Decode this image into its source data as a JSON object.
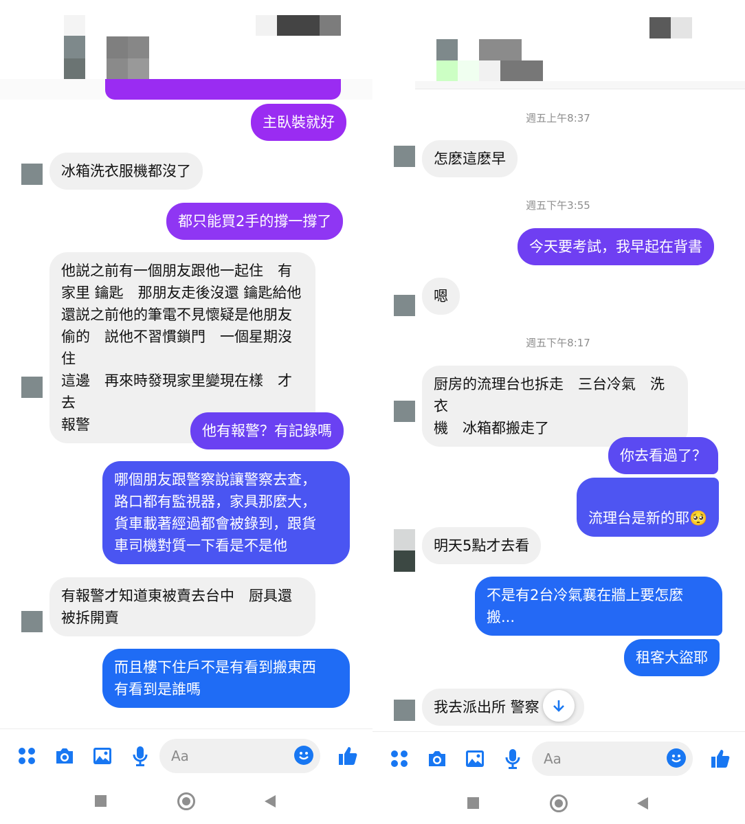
{
  "colors": {
    "purple": "#9a2cf2",
    "violet": "#6a41f2",
    "blue": "#1f6cf5",
    "incoming": "#f0f0f0"
  },
  "left_panel": {
    "messages": [
      {
        "side": "out",
        "text": "主臥裝就好",
        "color": "purple"
      },
      {
        "side": "in",
        "text": "冰箱洗衣服機都沒了"
      },
      {
        "side": "out",
        "text": "都只能買2手的撐一撐了",
        "color": "purple"
      },
      {
        "side": "in",
        "text": "他説之前有一個朋友跟他一起住　有\n家里 鑰匙　那朋友走後沒還 鑰匙給他\n還説之前他的筆電不見懷疑是他朋友\n偷的　説他不習慣鎖門　一個星期沒住\n這邊　再來時發現家里變現在樣　才去\n報警"
      },
      {
        "side": "out",
        "text": "他有報警？有記錄嗎",
        "color": "violet"
      },
      {
        "side": "out",
        "text": "哪個朋友跟警察說讓警察去查，\n路口都有監視器，家具那麼大，\n貨車載著經過都會被錄到，跟貨\n車司機對質一下看是不是他",
        "color": "violet"
      },
      {
        "side": "in",
        "text": "有報警才知道東被賣去台中　厨具還\n被拆開賣"
      },
      {
        "side": "out",
        "text": "而且樓下住戶不是有看到搬東西\n有看到是誰嗎",
        "color": "blue"
      }
    ],
    "composer": {
      "placeholder": "Aa"
    }
  },
  "right_panel": {
    "timestamps": [
      "週五上午8:37",
      "週五下午3:55",
      "週五下午8:17"
    ],
    "messages": [
      {
        "side": "in",
        "text": "怎麽這麽早"
      },
      {
        "side": "out",
        "text": "今天要考試，我早起在背書",
        "color": "violet"
      },
      {
        "side": "in",
        "text": "嗯"
      },
      {
        "side": "in",
        "text": "厨房的流理台也拆走　三台冷氣　洗衣\n機　冰箱都搬走了"
      },
      {
        "side": "out",
        "text": "你去看過了？",
        "color": "violet"
      },
      {
        "side": "out",
        "text": "流理台是新的耶",
        "color": "violet",
        "emoji": "🥺"
      },
      {
        "side": "in",
        "text": "明天5點才去看"
      },
      {
        "side": "out",
        "text": "不是有2台冷氣襄在牆上要怎麼\n搬...",
        "color": "blue"
      },
      {
        "side": "out",
        "text": "租客大盜耶",
        "color": "blue"
      },
      {
        "side": "in",
        "text": "我去派出所 警察"
      }
    ],
    "composer": {
      "placeholder": "Aa"
    }
  }
}
